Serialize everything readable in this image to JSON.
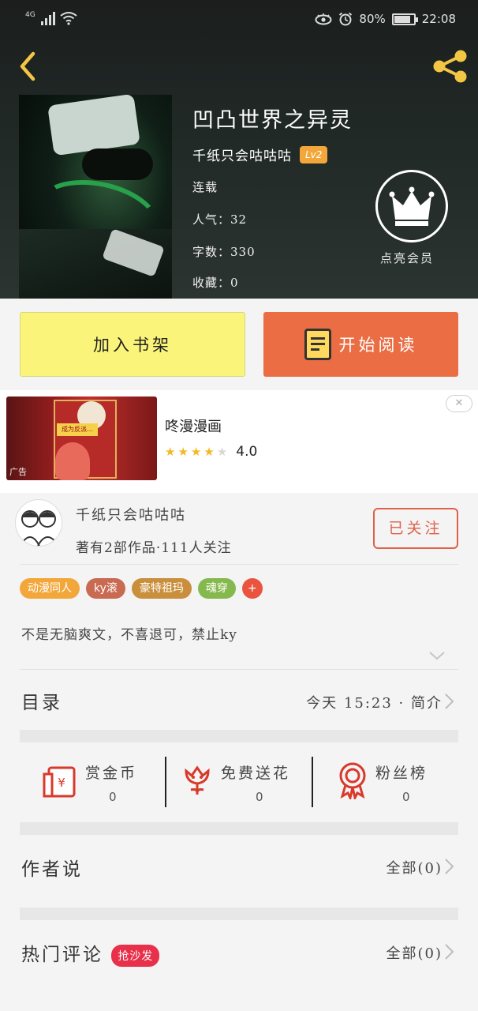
{
  "status_bar": {
    "network": "4G",
    "battery": "80%",
    "time": "22:08"
  },
  "book": {
    "title": "凹凸世界之异灵",
    "author": "千纸只会咕咕咕",
    "level": "Lv2",
    "status": "连载",
    "popularity_label": "人气：",
    "popularity": "32",
    "words_label": "字数：",
    "words": "330",
    "favorites_label": "收藏：",
    "favorites": "0"
  },
  "vip": {
    "label": "点亮会员",
    "icon": "crown-icon"
  },
  "actions": {
    "add_shelf": "加入书架",
    "start_read": "开始阅读"
  },
  "ad": {
    "title": "咚漫漫画",
    "rating": "4.0",
    "stars_filled": 4,
    "tag": "广告",
    "close": "✕",
    "image_caption": "成为反派…"
  },
  "author_info": {
    "name": "千纸只会咕咕咕",
    "works": "著有2部作品·111人关注",
    "follow": "已关注"
  },
  "tags": [
    {
      "label": "动漫同人",
      "color": "#f3a73a"
    },
    {
      "label": "ky滚",
      "color": "#c96a52"
    },
    {
      "label": "豪特祖玛",
      "color": "#c98f3c"
    },
    {
      "label": "魂穿",
      "color": "#86b94d"
    },
    {
      "label": "+",
      "color": "#e9543e"
    }
  ],
  "description": "不是无脑爽文，不喜退可，禁止ky",
  "catalog": {
    "label": "目录",
    "updated": "今天  15:23 · 简介"
  },
  "stats": {
    "reward": {
      "label": "赏金币",
      "value": "0"
    },
    "flowers": {
      "label": "免费送花",
      "value": "0"
    },
    "fans": {
      "label": "粉丝榜",
      "value": "0"
    }
  },
  "author_says": {
    "label": "作者说",
    "all": "全部(0)"
  },
  "hot_comments": {
    "label": "热门评论",
    "badge": "抢沙发",
    "all": "全部(0)"
  },
  "colors": {
    "accent_orange": "#ea6d44",
    "shelf_yellow": "#fbf47a",
    "follow_red": "#e0614a",
    "hot_red": "#e8304a",
    "gold": "#f3c744"
  }
}
